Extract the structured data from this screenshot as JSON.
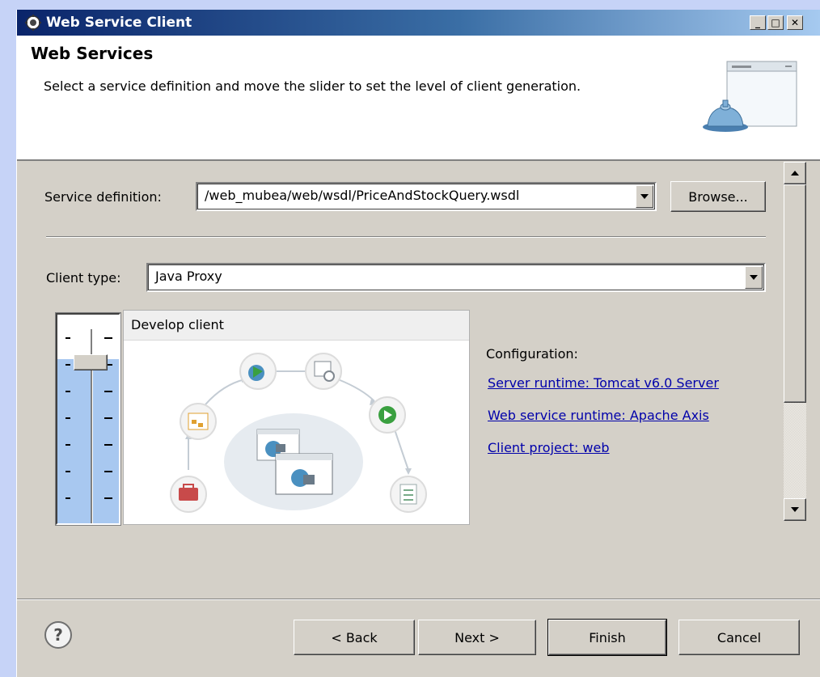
{
  "window": {
    "title": "Web Service Client",
    "controls": {
      "minimize": "_",
      "maximize": "□",
      "close": "✕"
    }
  },
  "banner": {
    "title": "Web Services",
    "description": "Select a service definition and move the slider to set the level of client generation."
  },
  "service_definition": {
    "label": "Service definition:",
    "value": "/web_mubea/web/wsdl/PriceAndStockQuery.wsdl",
    "browse_label": "Browse...",
    "browse_mnemonic": "r"
  },
  "client_type": {
    "label": "Client type:",
    "mnemonic": "C",
    "value": "Java Proxy"
  },
  "slider": {
    "level_fraction": 0.83
  },
  "preview": {
    "title": "Develop client"
  },
  "configuration": {
    "heading": "Configuration:",
    "links": [
      "Server runtime: Tomcat v6.0 Server",
      "Web service runtime: Apache Axis",
      "Client project: web"
    ]
  },
  "footer": {
    "help_icon": "?",
    "back_label": "< Back",
    "next_label": "Next >",
    "finish_label": "Finish",
    "cancel_label": "Cancel"
  },
  "colors": {
    "titlebar_start": "#0a246a",
    "titlebar_end": "#a6caf0",
    "dialog_bg": "#d4d0c8",
    "link": "#0000aa"
  }
}
